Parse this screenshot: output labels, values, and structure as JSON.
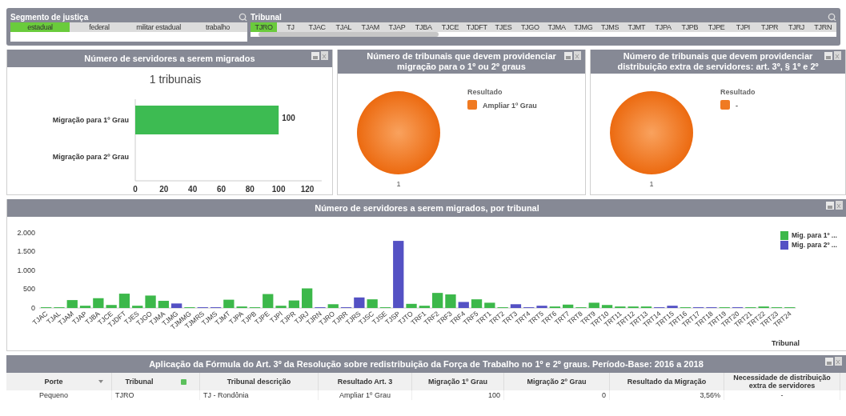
{
  "filters": [
    {
      "title": "Segmento de justiça",
      "items": [
        {
          "label": "estadual",
          "selected": true
        },
        {
          "label": "federal",
          "selected": false
        },
        {
          "label": "militar estadual",
          "selected": false
        },
        {
          "label": "trabalho",
          "selected": false
        }
      ]
    },
    {
      "title": "Tribunal",
      "items": [
        {
          "label": "TJRO",
          "selected": true
        },
        {
          "label": "TJ",
          "selected": false
        },
        {
          "label": "TJAC",
          "selected": false
        },
        {
          "label": "TJAL",
          "selected": false
        },
        {
          "label": "TJAM",
          "selected": false
        },
        {
          "label": "TJAP",
          "selected": false
        },
        {
          "label": "TJBA",
          "selected": false
        },
        {
          "label": "TJCE",
          "selected": false
        },
        {
          "label": "TJDFT",
          "selected": false
        },
        {
          "label": "TJES",
          "selected": false
        },
        {
          "label": "TJGO",
          "selected": false
        },
        {
          "label": "TJMA",
          "selected": false
        },
        {
          "label": "TJMG",
          "selected": false
        },
        {
          "label": "TJMS",
          "selected": false
        },
        {
          "label": "TJMT",
          "selected": false
        },
        {
          "label": "TJPA",
          "selected": false
        },
        {
          "label": "TJPB",
          "selected": false
        },
        {
          "label": "TJPE",
          "selected": false
        },
        {
          "label": "TJPI",
          "selected": false
        },
        {
          "label": "TJPR",
          "selected": false
        },
        {
          "label": "TJRJ",
          "selected": false
        },
        {
          "label": "TJRN",
          "selected": false
        }
      ]
    }
  ],
  "summary_panels": [
    {
      "title": "Número de servidores a serem migrados",
      "chart_data": {
        "type": "bar",
        "orientation": "horizontal",
        "title": "1 tribunais",
        "categories": [
          "Migração para 1º Grau",
          "Migração para 2º Grau"
        ],
        "values": [
          100,
          null
        ],
        "xlim": [
          0,
          130
        ],
        "xticks": [
          0,
          20,
          40,
          60,
          80,
          100,
          120
        ],
        "data_labels": true
      }
    },
    {
      "title": "Número de tribunais que devem providenciar migração para o 1º ou 2º graus",
      "chart_data": {
        "type": "pie",
        "categories": [
          "Ampliar 1º Grau"
        ],
        "values": [
          1
        ],
        "legend": "right",
        "legend_title": "Resultado",
        "data_labels": true
      }
    },
    {
      "title": "Número de tribunais que devem providenciar distribuição extra de servidores: art. 3º, § 1º e 2º",
      "chart_data": {
        "type": "pie",
        "categories": [
          "-"
        ],
        "values": [
          1
        ],
        "legend": "right",
        "legend_title": "Resultado",
        "data_labels": true
      }
    }
  ],
  "tribunal_chart": {
    "title": "Número de servidores a serem migrados, por tribunal",
    "chart_data": {
      "type": "bar",
      "stacked": true,
      "legend": "top right",
      "xlabel": "Tribunal",
      "categories": [
        "TJAC",
        "TJAL",
        "TJAM",
        "TJAP",
        "TJBA",
        "TJCE",
        "TJDFT",
        "TJES",
        "TJGO",
        "TJMA",
        "TJMG",
        "TJMMG",
        "TJMRS",
        "TJMS",
        "TJMT",
        "TJPA",
        "TJPB",
        "TJPE",
        "TJPI",
        "TJPR",
        "TJRJ",
        "TJRN",
        "TJRO",
        "TJRR",
        "TJRS",
        "TJSC",
        "TJSE",
        "TJSP",
        "TJTO",
        "TRF1",
        "TRF2",
        "TRF3",
        "TRF4",
        "TRF5",
        "TRT1",
        "TRT2",
        "TRT3",
        "TRT4",
        "TRT5",
        "TRT6",
        "TRT7",
        "TRT8",
        "TRT9",
        "TRT10",
        "TRT11",
        "TRT12",
        "TRT13",
        "TRT14",
        "TRT15",
        "TRT16",
        "TRT17",
        "TRT18",
        "TRT19",
        "TRT20",
        "TRT21",
        "TRT22",
        "TRT23",
        "TRT24"
      ],
      "series": [
        {
          "name": "Mig. para 1º ...",
          "color": "#3cb84a",
          "values": [
            20,
            20,
            210,
            60,
            260,
            80,
            380,
            60,
            330,
            190,
            null,
            20,
            null,
            null,
            220,
            40,
            20,
            370,
            60,
            200,
            520,
            null,
            100,
            null,
            null,
            230,
            20,
            null,
            110,
            60,
            400,
            360,
            null,
            230,
            140,
            20,
            null,
            null,
            null,
            40,
            90,
            20,
            140,
            80,
            40,
            40,
            40,
            null,
            null,
            20,
            null,
            null,
            20,
            null,
            20,
            40,
            20,
            20
          ]
        },
        {
          "name": "Mig. para 2º ...",
          "color": "#5451c4",
          "values": [
            null,
            null,
            null,
            null,
            null,
            null,
            null,
            null,
            null,
            null,
            120,
            null,
            20,
            20,
            null,
            null,
            null,
            null,
            null,
            null,
            null,
            20,
            null,
            20,
            280,
            null,
            null,
            1780,
            null,
            null,
            null,
            null,
            160,
            null,
            null,
            null,
            100,
            20,
            60,
            null,
            null,
            null,
            null,
            null,
            null,
            null,
            null,
            20,
            60,
            null,
            20,
            20,
            null,
            20,
            null,
            null,
            null,
            null
          ]
        }
      ],
      "ylim": [
        0,
        2100
      ],
      "yticks": [
        {
          "value": 0,
          "label": "0"
        },
        {
          "value": 500,
          "label": "500"
        },
        {
          "value": 1000,
          "label": "1.000"
        },
        {
          "value": 1500,
          "label": "1.500"
        },
        {
          "value": 2000,
          "label": "2.000"
        }
      ]
    }
  },
  "table": {
    "title": "Aplicação da Fórmula do Art. 3º da Resolução sobre redistribuição da Força de Trabalho no 1º e 2º graus. Período-Base: 2016 a 2018",
    "columns": [
      {
        "label": "Porte",
        "kind": "sort"
      },
      {
        "label": "Tribunal",
        "kind": "filtered"
      },
      {
        "label": "Tribunal descrição",
        "kind": "plain"
      },
      {
        "label": "Resultado Art. 3",
        "kind": "plain"
      },
      {
        "label": "Migração 1º Grau",
        "kind": "plain"
      },
      {
        "label": "Migração 2º Grau",
        "kind": "plain"
      },
      {
        "label": "Resultado da Migração",
        "kind": "plain"
      },
      {
        "label": "Necessidade de distribuição extra de servidores",
        "kind": "plain"
      }
    ],
    "rows": [
      [
        "Pequeno",
        "TJRO",
        "TJ - Rondônia",
        "Ampliar 1º Grau",
        "100",
        "0",
        "3,56%",
        "-"
      ]
    ]
  }
}
